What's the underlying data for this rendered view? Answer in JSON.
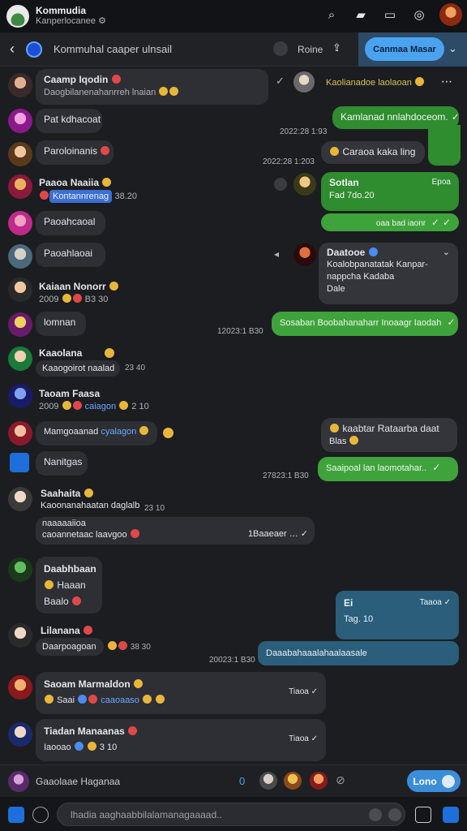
{
  "app": {
    "title": "Kommudia",
    "subtitle": "Kanperlocanee",
    "subtitle_icon": "gear-icon"
  },
  "top_icons": [
    "search-icon",
    "bookmark-icon",
    "calendar-icon",
    "camera-icon",
    "profile-avatar"
  ],
  "conversation": {
    "title": "Kommuhal caaper ulnsail",
    "action_label": "Roine",
    "share_icon": "share-icon",
    "cta_label": "Canmaa Masar"
  },
  "messages": [
    {
      "side": "left",
      "name": "Caamp Iqodin",
      "text": "Daogbilanenahanrreh lnaian"
    },
    {
      "side": "right",
      "name": "Kaolianadoe laolaoan"
    },
    {
      "side": "left",
      "text": "Pat kdhacoat"
    },
    {
      "side": "right",
      "text": "Kamlanad nnlahdoceom."
    },
    {
      "ts": "2022:28 1:93"
    },
    {
      "side": "left",
      "text": "Paroloinanis"
    },
    {
      "side": "right",
      "text": "Caraoa kaka ling"
    },
    {
      "ts": "2022:28 1:203"
    },
    {
      "side": "left",
      "name": "Paaoa Naaiia",
      "chip": "Kontannrenag",
      "time": "38.20"
    },
    {
      "side": "right",
      "name": "Sotlan",
      "sub": "Fad 7do.20",
      "time": "Epoa"
    },
    {
      "side": "right",
      "text": "oaa bad iaonr"
    },
    {
      "side": "left",
      "text": "Paoahcaoal"
    },
    {
      "side": "left",
      "text": "Paoahlaoai"
    },
    {
      "side": "right",
      "name": "Daatooe",
      "text": "Koalobpanatatak Kanpar-",
      "sub": "nappcha Kadaba",
      "extra": "Dale"
    },
    {
      "side": "left",
      "name": "Kaiaan Nonorr",
      "sub": "2009",
      "time": "B3 30"
    },
    {
      "side": "left",
      "text": "lomnan"
    },
    {
      "side": "right",
      "text": "Sosaban Boobahanaharr Inoaagr Iaodah"
    },
    {
      "ts": "12023:1 B30"
    },
    {
      "side": "left",
      "name": "Kaaolana",
      "text": "Kaaogoirot naalad",
      "time": "23 40"
    },
    {
      "side": "left",
      "name": "Taoam Faasa",
      "sub": "2009",
      "link": "caiagon",
      "time": "2 10"
    },
    {
      "side": "left",
      "text": "Mamgoaanad",
      "link": "cyalagon"
    },
    {
      "side": "right",
      "text": "kaabtar Rataarba daat",
      "sub": "Blas"
    },
    {
      "side": "left",
      "text": "Nanitgas"
    },
    {
      "side": "right",
      "text": "Saaipoal lan laomotahar.."
    },
    {
      "ts": "27823:1 B30"
    },
    {
      "side": "left",
      "name": "Saahaita",
      "text": "Kaoonanahaatan daglalb",
      "sub": "naaaaaiioa",
      "extra": "caoannetaac laavgoo",
      "time": "23 10",
      "meta": "1Baaeaer"
    },
    {
      "side": "left",
      "name": "Daabhbaan",
      "text": "Haaan",
      "sub": "Baalo"
    },
    {
      "side": "right",
      "name": "Ei",
      "sub": "Tag. 10",
      "time": "Taaoa"
    },
    {
      "side": "left",
      "name": "Lilanana",
      "sub": "Daarpoagoan",
      "time": "38 30"
    },
    {
      "side": "right",
      "text": "Daaabahaaalahaalaasale"
    },
    {
      "ts": "20023:1 B30"
    },
    {
      "side": "left",
      "name": "Saoam Marmaldon",
      "sub": "Saai",
      "link": "caaoaaso",
      "time": "Tiaoa"
    },
    {
      "side": "left",
      "name": "Tiadan Manaanas",
      "sub": "Iaooao",
      "time": "Tiaoa",
      "extra": "3 10"
    }
  ],
  "composer": {
    "text": "Gaaolaae Haganaa",
    "count": "0",
    "send_label": "Lono"
  },
  "input": {
    "placeholder": "lhadia aaghaabbilalamanagaaaad.."
  },
  "colors": {
    "background": "#1c1d21",
    "bubble": "#2d2f34",
    "sent_green": "#2f8c2f",
    "sent_teal": "#2a5e7a",
    "accent_blue": "#4aa3f0"
  }
}
